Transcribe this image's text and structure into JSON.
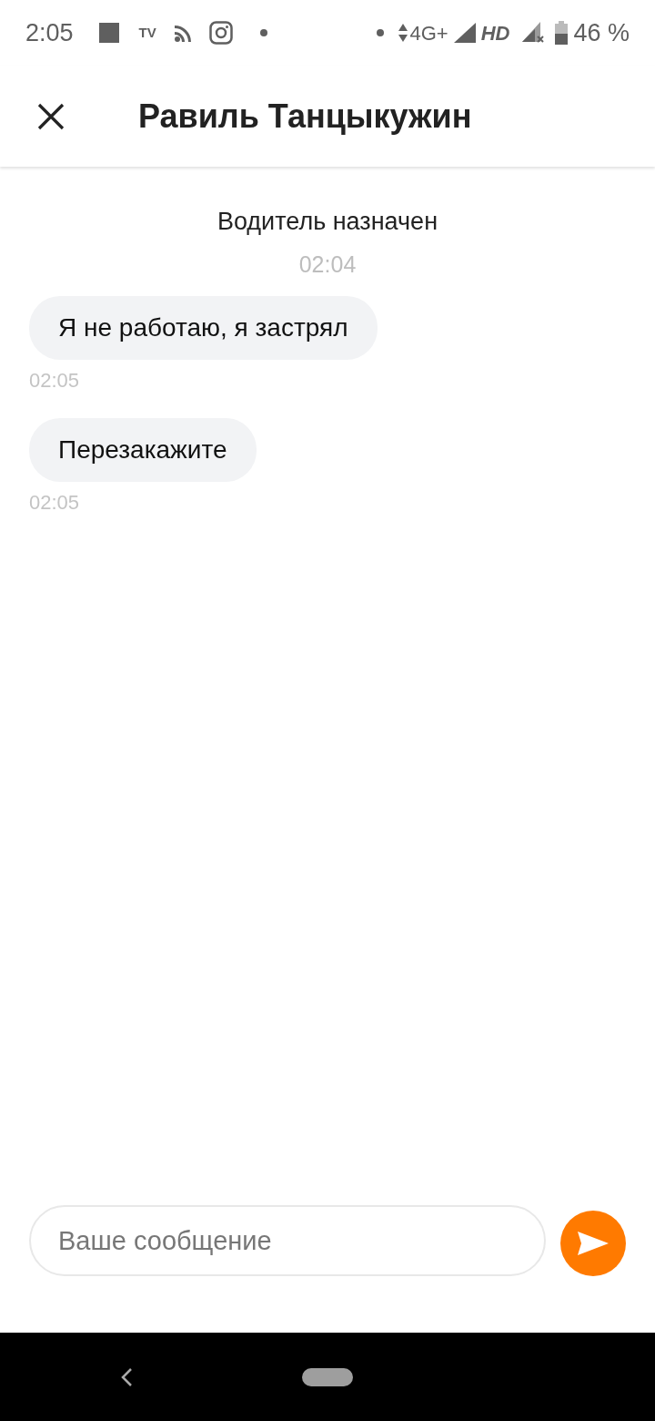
{
  "status_bar": {
    "time": "2:05",
    "tv_label": "TV",
    "network": "4G+",
    "hd_label": "HD",
    "battery": "46 %"
  },
  "header": {
    "title": "Равиль Танцыкужин"
  },
  "messages": [
    {
      "kind": "system",
      "text": "Водитель назначен",
      "time": "02:04"
    },
    {
      "kind": "incoming",
      "text": "Я не работаю, я застрял",
      "time": "02:05"
    },
    {
      "kind": "incoming",
      "text": "Перезакажите",
      "time": "02:05"
    }
  ],
  "composer": {
    "placeholder": "Ваше сообщение"
  }
}
